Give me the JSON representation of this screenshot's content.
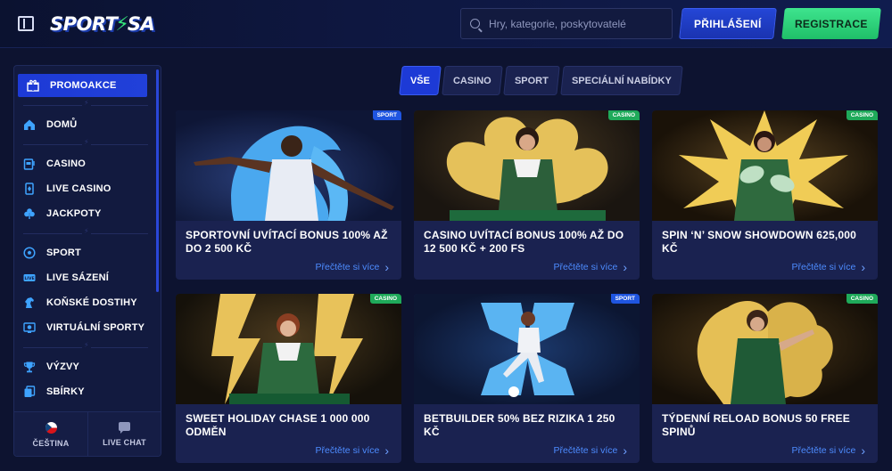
{
  "header": {
    "logo_text_left": "SPORT",
    "logo_text_right": "SA",
    "search_placeholder": "Hry, kategorie, poskytovatelé",
    "login_label": "PŘIHLÁŠENÍ",
    "register_label": "REGISTRACE"
  },
  "sidebar": {
    "items": [
      {
        "label": "PROMOAKCE",
        "icon": "gift-icon"
      },
      {
        "label": "DOMŮ",
        "icon": "home-icon"
      },
      {
        "label": "CASINO",
        "icon": "slot-machine-icon"
      },
      {
        "label": "LIVE CASINO",
        "icon": "card-icon"
      },
      {
        "label": "JACKPOTY",
        "icon": "clover-icon"
      },
      {
        "label": "SPORT",
        "icon": "ball-icon"
      },
      {
        "label": "LIVE SÁZENÍ",
        "icon": "live-icon"
      },
      {
        "label": "KOŇSKÉ DOSTIHY",
        "icon": "horse-icon"
      },
      {
        "label": "VIRTUÁLNÍ SPORTY",
        "icon": "virtual-icon"
      },
      {
        "label": "VÝZVY",
        "icon": "trophy-icon"
      },
      {
        "label": "SBÍRKY",
        "icon": "collection-icon"
      }
    ],
    "language_label": "ČEŠTINA",
    "chat_label": "LIVE CHAT"
  },
  "tabs": [
    {
      "label": "VŠE",
      "active": true
    },
    {
      "label": "CASINO",
      "active": false
    },
    {
      "label": "SPORT",
      "active": false
    },
    {
      "label": "SPECIÁLNÍ NABÍDKY",
      "active": false
    }
  ],
  "cards": [
    {
      "title": "SPORTOVNÍ UVÍTACÍ BONUS 100% AŽ DO 2 500 KČ",
      "badge": "SPORT",
      "link": "Přečtěte si více"
    },
    {
      "title": "CASINO UVÍTACÍ BONUS 100% AŽ DO 12 500 KČ + 200 FS",
      "badge": "CASINO",
      "link": "Přečtěte si více"
    },
    {
      "title": "SPIN ‘N’ SNOW SHOWDOWN 625,000 KČ",
      "badge": "CASINO",
      "link": "Přečtěte si více"
    },
    {
      "title": "SWEET HOLIDAY CHASE 1 000 000 ODMĚN",
      "badge": "CASINO",
      "link": "Přečtěte si více"
    },
    {
      "title": "BETBUILDER 50% BEZ RIZIKA 1 250 KČ",
      "badge": "SPORT",
      "link": "Přečtěte si více"
    },
    {
      "title": "TÝDENNÍ RELOAD BONUS 50 FREE SPINŮ",
      "badge": "CASINO",
      "link": "Přečtěte si více"
    }
  ],
  "colors": {
    "accent_blue": "#1d3ad6",
    "accent_green": "#34e27a",
    "background": "#0d1330",
    "link": "#4d8cff"
  }
}
